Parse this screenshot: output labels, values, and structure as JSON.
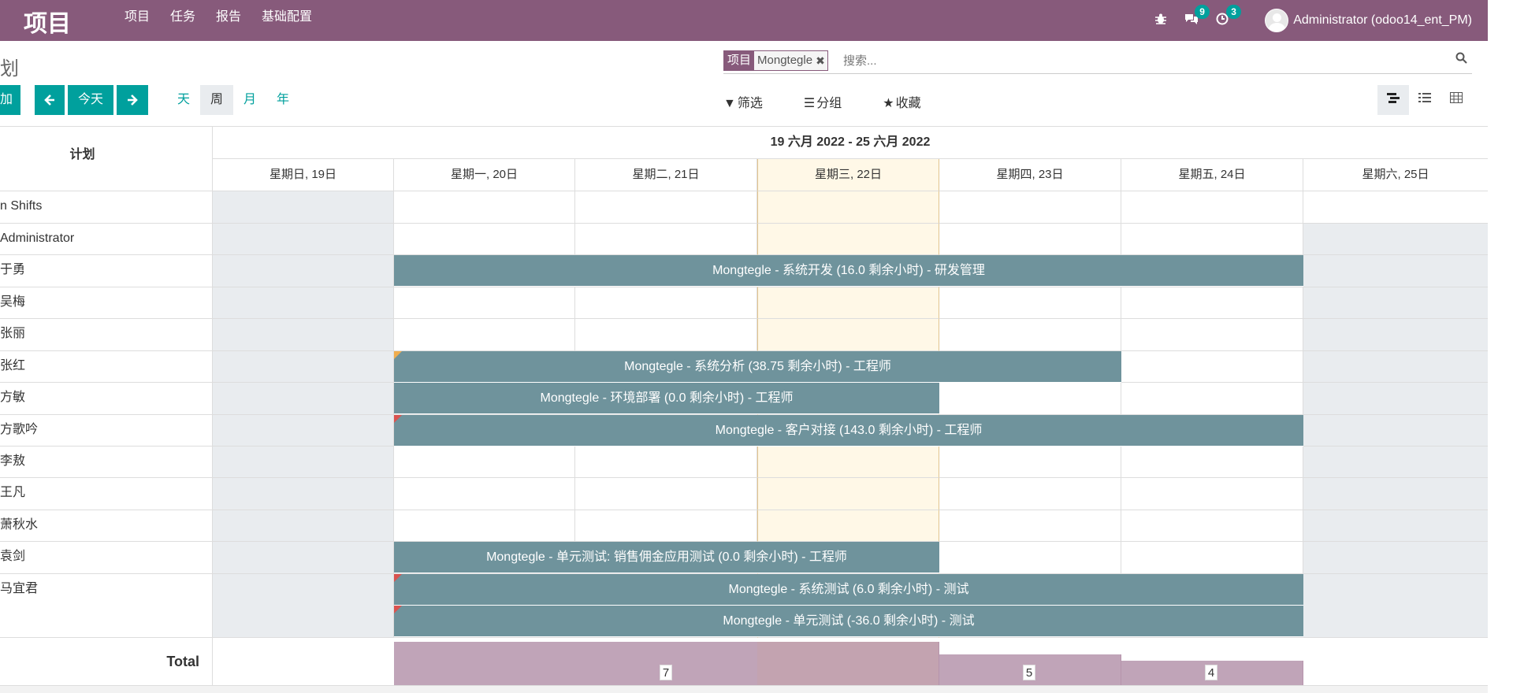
{
  "navbar": {
    "brand": "项目",
    "menu": [
      "项目",
      "任务",
      "报告",
      "基础配置"
    ],
    "messages_count": "9",
    "activities_count": "3",
    "user": "Administrator (odoo14_ent_PM)"
  },
  "control": {
    "breadcrumb": "划",
    "add_label": "加",
    "today_label": "今天",
    "scales": [
      "天",
      "周",
      "月",
      "年"
    ],
    "active_scale": "周",
    "facet_label": "项目",
    "facet_value": "Mongtegle",
    "search_placeholder": "搜索...",
    "filter_label": "筛选",
    "group_label": "分组",
    "favorite_label": "收藏"
  },
  "gantt": {
    "plan_header": "计划",
    "range": "19 六月 2022 - 25 六月 2022",
    "days": [
      "星期日, 19日",
      "星期一, 20日",
      "星期二, 21日",
      "星期三, 22日",
      "星期四, 23日",
      "星期五, 24日",
      "星期六, 25日"
    ],
    "rows": [
      "n Shifts",
      "Administrator",
      "于勇",
      "吴梅",
      "张丽",
      "张红",
      "方敏",
      "方歌吟",
      "李敖",
      "王凡",
      "萧秋水",
      "袁剑",
      "马宜君"
    ],
    "pills": {
      "yuyong": "Mongtegle - 系统开发 (16.0 剩余小时) - 研发管理",
      "zhanghong": "Mongtegle - 系统分析 (38.75 剩余小时) - 工程师",
      "fangmin": "Mongtegle - 环境部署 (0.0 剩余小时) - 工程师",
      "fanggeyin": "Mongtegle - 客户对接 (143.0 剩余小时) - 工程师",
      "yuanjian": "Mongtegle - 单元测试: 销售佣金应用测试 (0.0 剩余小时) - 工程师",
      "mayijun_1": "Mongtegle - 系统测试 (6.0 剩余小时) - 测试",
      "mayijun_2": "Mongtegle - 单元测试 (-36.0 剩余小时) - 测试"
    },
    "total_label": "Total",
    "totals": [
      "",
      "7",
      "",
      "",
      "5",
      "4",
      ""
    ]
  },
  "colors": {
    "navbar": "#875A7B",
    "accent": "#00A09D",
    "pill": "#6f939c",
    "total_bar": "#c0a4b8",
    "today": "#fff8e7"
  }
}
